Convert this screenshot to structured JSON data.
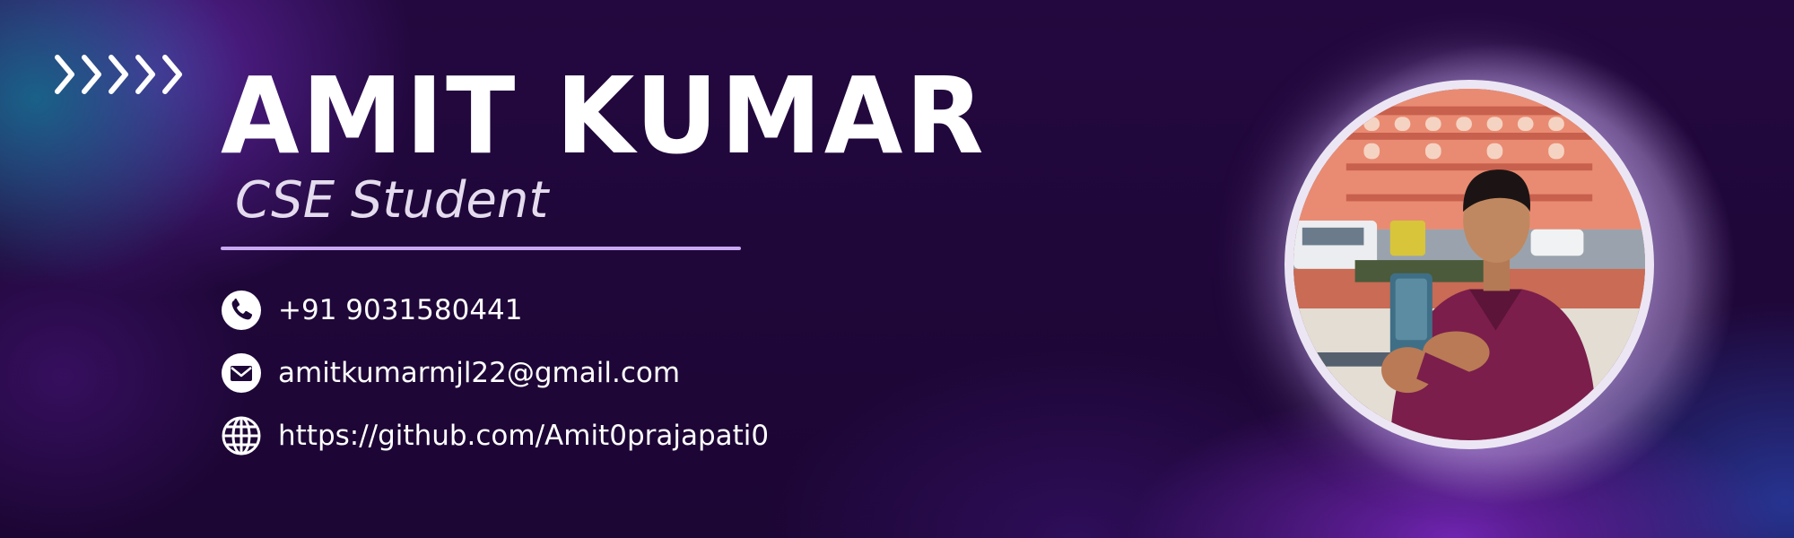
{
  "profile": {
    "name": "AMIT KUMAR",
    "role": "CSE Student"
  },
  "contacts": {
    "phone": {
      "icon": "phone-icon",
      "text": "+91 9031580441"
    },
    "email": {
      "icon": "mail-icon",
      "text": "amitkumarmjl22@gmail.com"
    },
    "website": {
      "icon": "globe-icon",
      "text": "https://github.com/Amit0prajapati0"
    }
  },
  "decor": {
    "chevrons_icon": "double-chevron-right-icon",
    "photo_icon": "profile-photo"
  },
  "colors": {
    "background": "#21083f",
    "accent_line": "#c9a9f2",
    "text": "#ffffff",
    "photo_ring": "#ece6f4"
  }
}
